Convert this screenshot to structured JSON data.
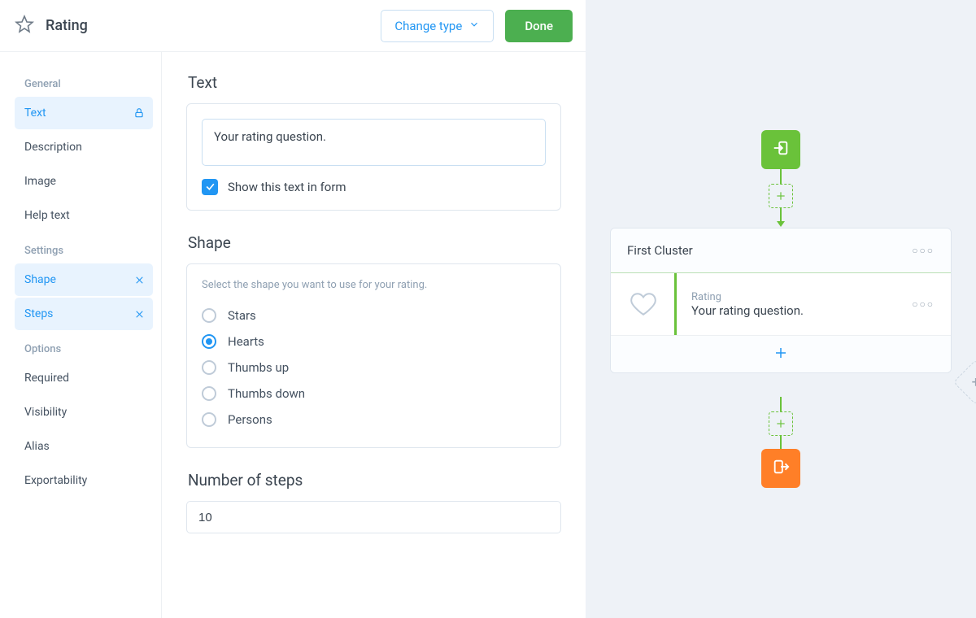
{
  "header": {
    "title": "Rating",
    "change_type_label": "Change type",
    "done_label": "Done"
  },
  "sidebar": {
    "groups": [
      {
        "title": "General",
        "items": [
          {
            "label": "Text",
            "active": true,
            "locked": true
          },
          {
            "label": "Description"
          },
          {
            "label": "Image"
          },
          {
            "label": "Help text"
          }
        ]
      },
      {
        "title": "Settings",
        "items": [
          {
            "label": "Shape",
            "active": true,
            "removable": true
          },
          {
            "label": "Steps",
            "active": true,
            "removable": true
          }
        ]
      },
      {
        "title": "Options",
        "items": [
          {
            "label": "Required"
          },
          {
            "label": "Visibility"
          },
          {
            "label": "Alias"
          },
          {
            "label": "Exportability"
          }
        ]
      }
    ]
  },
  "text_section": {
    "title": "Text",
    "value": "Your rating question.",
    "checkbox_label": "Show this text in form",
    "checked": true
  },
  "shape_section": {
    "title": "Shape",
    "hint": "Select the shape you want to use for your rating.",
    "options": [
      {
        "label": "Stars",
        "selected": false
      },
      {
        "label": "Hearts",
        "selected": true
      },
      {
        "label": "Thumbs up",
        "selected": false
      },
      {
        "label": "Thumbs down",
        "selected": false
      },
      {
        "label": "Persons",
        "selected": false
      }
    ]
  },
  "steps_section": {
    "title": "Number of steps",
    "value": "10"
  },
  "preview": {
    "cluster_title": "First Cluster",
    "field_tag": "Rating",
    "field_value": "Your rating question."
  },
  "icons": {
    "star": "star-icon",
    "chevron_down": "chevron-down-icon",
    "lock": "lock-icon",
    "close": "close-icon",
    "check": "check-icon",
    "plus": "plus-icon",
    "heart": "heart-icon",
    "enter": "enter-icon",
    "exit": "exit-icon",
    "more": "more-icon"
  }
}
